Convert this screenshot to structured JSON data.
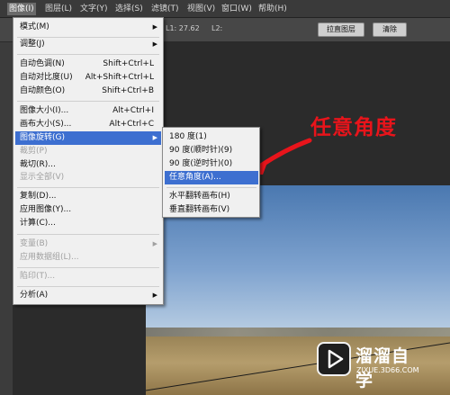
{
  "menubar": {
    "items": [
      {
        "label": "图像(I)",
        "active": true
      },
      {
        "label": "图层(L)"
      },
      {
        "label": "文字(Y)"
      },
      {
        "label": "选择(S)"
      },
      {
        "label": "滤镜(T)"
      },
      {
        "label": "视图(V)"
      },
      {
        "label": "窗口(W)"
      },
      {
        "label": "帮助(H)"
      }
    ]
  },
  "options_bar": {
    "field1": "L1: 27.62",
    "field2": "L2:",
    "straighten_button": "拉直图层",
    "clear_button": "清除"
  },
  "image_menu": {
    "items": [
      {
        "label": "模式(M)",
        "submenu": true
      },
      {
        "label": "调整(J)",
        "submenu": true
      },
      {
        "label": "自动色调(N)",
        "shortcut": "Shift+Ctrl+L"
      },
      {
        "label": "自动对比度(U)",
        "shortcut": "Alt+Shift+Ctrl+L"
      },
      {
        "label": "自动颜色(O)",
        "shortcut": "Shift+Ctrl+B"
      },
      {
        "label": "图像大小(I)...",
        "shortcut": "Alt+Ctrl+I"
      },
      {
        "label": "画布大小(S)...",
        "shortcut": "Alt+Ctrl+C"
      },
      {
        "label": "图像旋转(G)",
        "submenu": true,
        "highlighted": true
      },
      {
        "label": "裁剪(P)",
        "disabled": true
      },
      {
        "label": "裁切(R)..."
      },
      {
        "label": "显示全部(V)",
        "disabled": true
      },
      {
        "label": "复制(D)..."
      },
      {
        "label": "应用图像(Y)..."
      },
      {
        "label": "计算(C)..."
      },
      {
        "label": "变量(B)",
        "submenu": true,
        "disabled": true
      },
      {
        "label": "应用数据组(L)...",
        "disabled": true
      },
      {
        "label": "陷印(T)...",
        "disabled": true
      },
      {
        "label": "分析(A)",
        "submenu": true
      }
    ]
  },
  "rotation_submenu": {
    "items": [
      {
        "label": "180 度(1)"
      },
      {
        "label": "90 度(顺时针)(9)"
      },
      {
        "label": "90 度(逆时针)(0)"
      },
      {
        "label": "任意角度(A)...",
        "highlighted": true
      },
      {
        "label": "水平翻转画布(H)"
      },
      {
        "label": "垂直翻转画布(V)"
      }
    ]
  },
  "annotation": {
    "text": "任意角度",
    "color": "#e8141b"
  },
  "watermark": {
    "name": "溜溜自学",
    "url": "ZIXUE.3D66.COM",
    "icon": "play-triangle-icon"
  },
  "colors": {
    "menu_highlight": "#3d6fd0",
    "menubar_bg": "#3a3a3a",
    "workspace_bg": "#2b2b2b"
  }
}
